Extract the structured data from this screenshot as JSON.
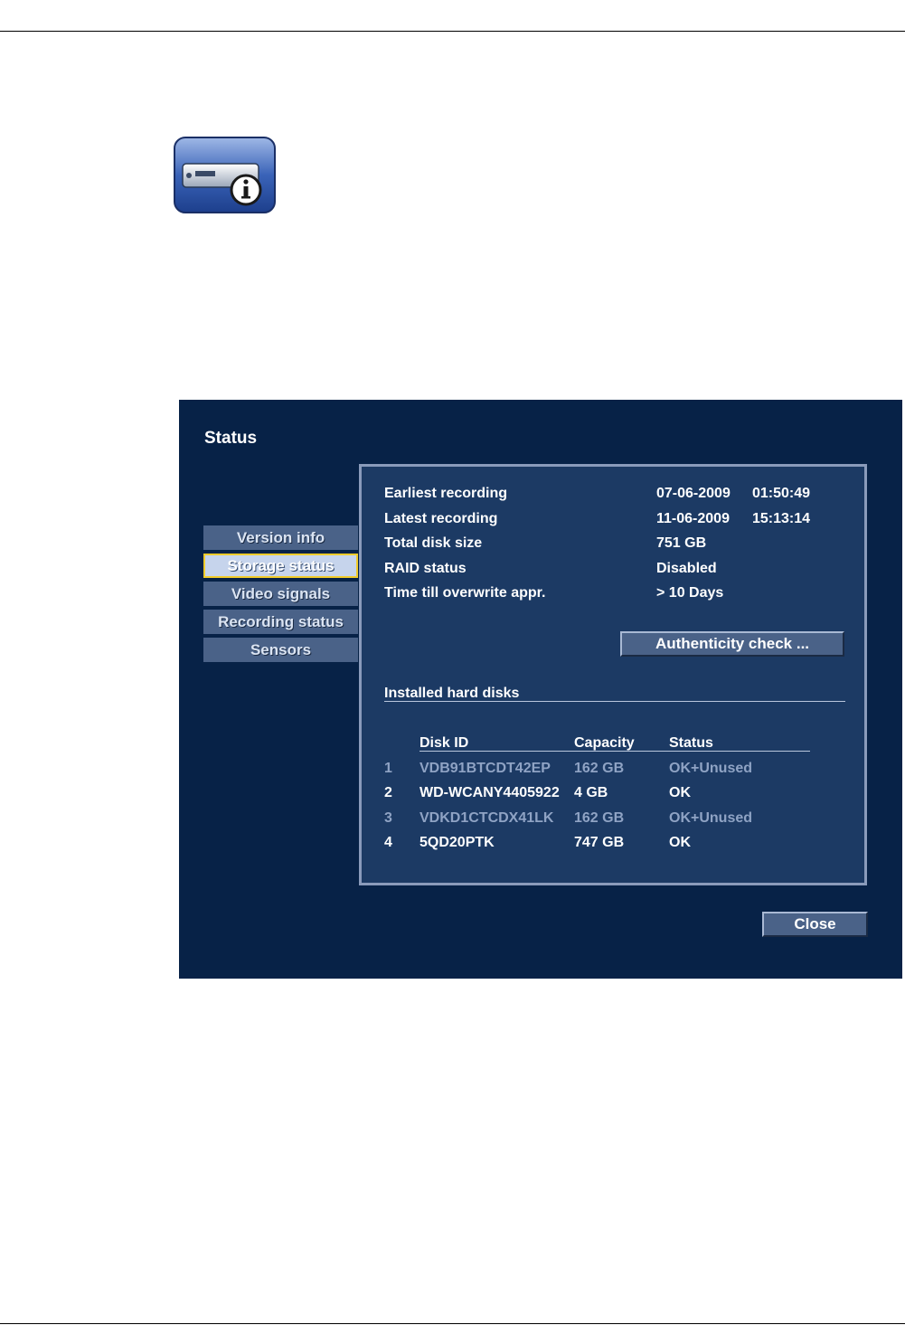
{
  "screen": {
    "title": "Status",
    "menu": [
      {
        "label": "Version info",
        "active": false
      },
      {
        "label": "Storage status",
        "active": true
      },
      {
        "label": "Video signals",
        "active": false
      },
      {
        "label": "Recording status",
        "active": false
      },
      {
        "label": "Sensors",
        "active": false
      }
    ],
    "info": {
      "earliest_label": "Earliest recording",
      "earliest_date": "07-06-2009",
      "earliest_time": "01:50:49",
      "latest_label": "Latest recording",
      "latest_date": "11-06-2009",
      "latest_time": "15:13:14",
      "disk_size_label": "Total disk size",
      "disk_size_value": "751 GB",
      "raid_label": "RAID status",
      "raid_value": "Disabled",
      "overwrite_label": "Time till overwrite appr.",
      "overwrite_value": "> 10 Days"
    },
    "authenticity_button": "Authenticity check ...",
    "disks_section": "Installed hard disks",
    "disks_headers": {
      "id": "Disk ID",
      "capacity": "Capacity",
      "status": "Status"
    },
    "disks": [
      {
        "num": "1",
        "id": "VDB91BTCDT42EP",
        "capacity": "162 GB",
        "status": "OK+Unused"
      },
      {
        "num": "2",
        "id": "WD-WCANY4405922",
        "capacity": "4 GB",
        "status": "OK"
      },
      {
        "num": "3",
        "id": "VDKD1CTCDX41LK",
        "capacity": "162 GB",
        "status": "OK+Unused"
      },
      {
        "num": "4",
        "id": "5QD20PTK",
        "capacity": "747 GB",
        "status": "OK"
      }
    ],
    "close_button": "Close"
  },
  "icons": {
    "app_icon": "dvr-info-icon"
  }
}
